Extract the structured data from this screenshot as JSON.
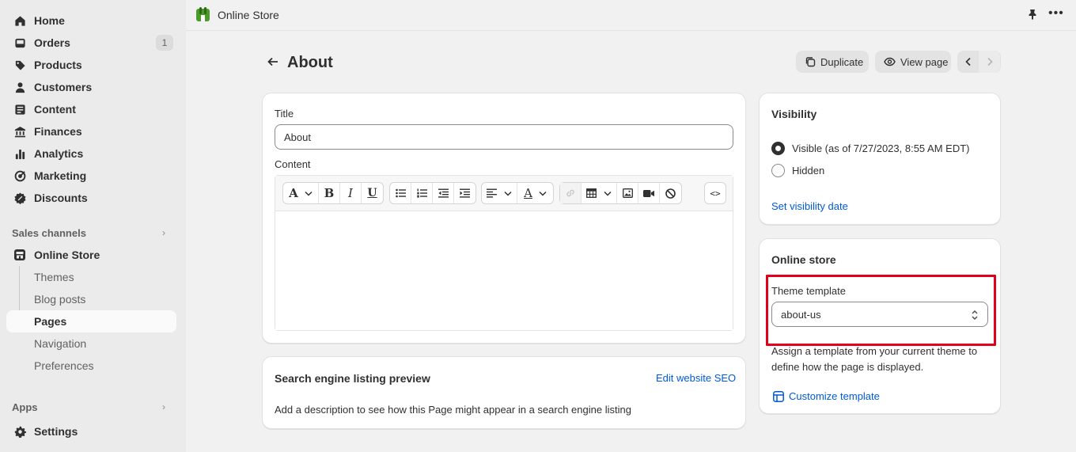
{
  "sidebar": {
    "items": [
      {
        "label": "Home",
        "icon": "home-icon"
      },
      {
        "label": "Orders",
        "icon": "orders-icon",
        "badge": "1"
      },
      {
        "label": "Products",
        "icon": "tag-icon"
      },
      {
        "label": "Customers",
        "icon": "person-icon"
      },
      {
        "label": "Content",
        "icon": "content-icon"
      },
      {
        "label": "Finances",
        "icon": "bank-icon"
      },
      {
        "label": "Analytics",
        "icon": "bar-chart-icon"
      },
      {
        "label": "Marketing",
        "icon": "target-icon"
      },
      {
        "label": "Discounts",
        "icon": "discount-icon"
      }
    ],
    "sales_channels_label": "Sales channels",
    "online_store": "Online Store",
    "sub_items": [
      "Themes",
      "Blog posts",
      "Pages",
      "Navigation",
      "Preferences"
    ],
    "apps_label": "Apps",
    "settings": "Settings"
  },
  "topbar": {
    "title": "Online Store"
  },
  "header": {
    "title": "About",
    "duplicate_label": "Duplicate",
    "view_page_label": "View page"
  },
  "main": {
    "title_label": "Title",
    "title_value": "About",
    "content_label": "Content",
    "toolbar": {
      "font": "A",
      "bold": "B",
      "italic": "I",
      "underline": "U",
      "color": "A",
      "html": "<>"
    }
  },
  "seo": {
    "title": "Search engine listing preview",
    "edit_link": "Edit website SEO",
    "description": "Add a description to see how this Page might appear in a search engine listing"
  },
  "visibility": {
    "title": "Visibility",
    "visible_label": "Visible (as of 7/27/2023, 8:55 AM EDT)",
    "hidden_label": "Hidden",
    "selected": "visible",
    "set_date_link": "Set visibility date"
  },
  "online_store_card": {
    "title": "Online store",
    "template_label": "Theme template",
    "template_value": "about-us",
    "description": "Assign a template from your current theme to define how the page is displayed.",
    "customize_link": "Customize template"
  },
  "colors": {
    "accent": "#005bd3",
    "highlight": "#e0001a",
    "brand_green": "#4c9a2a"
  }
}
